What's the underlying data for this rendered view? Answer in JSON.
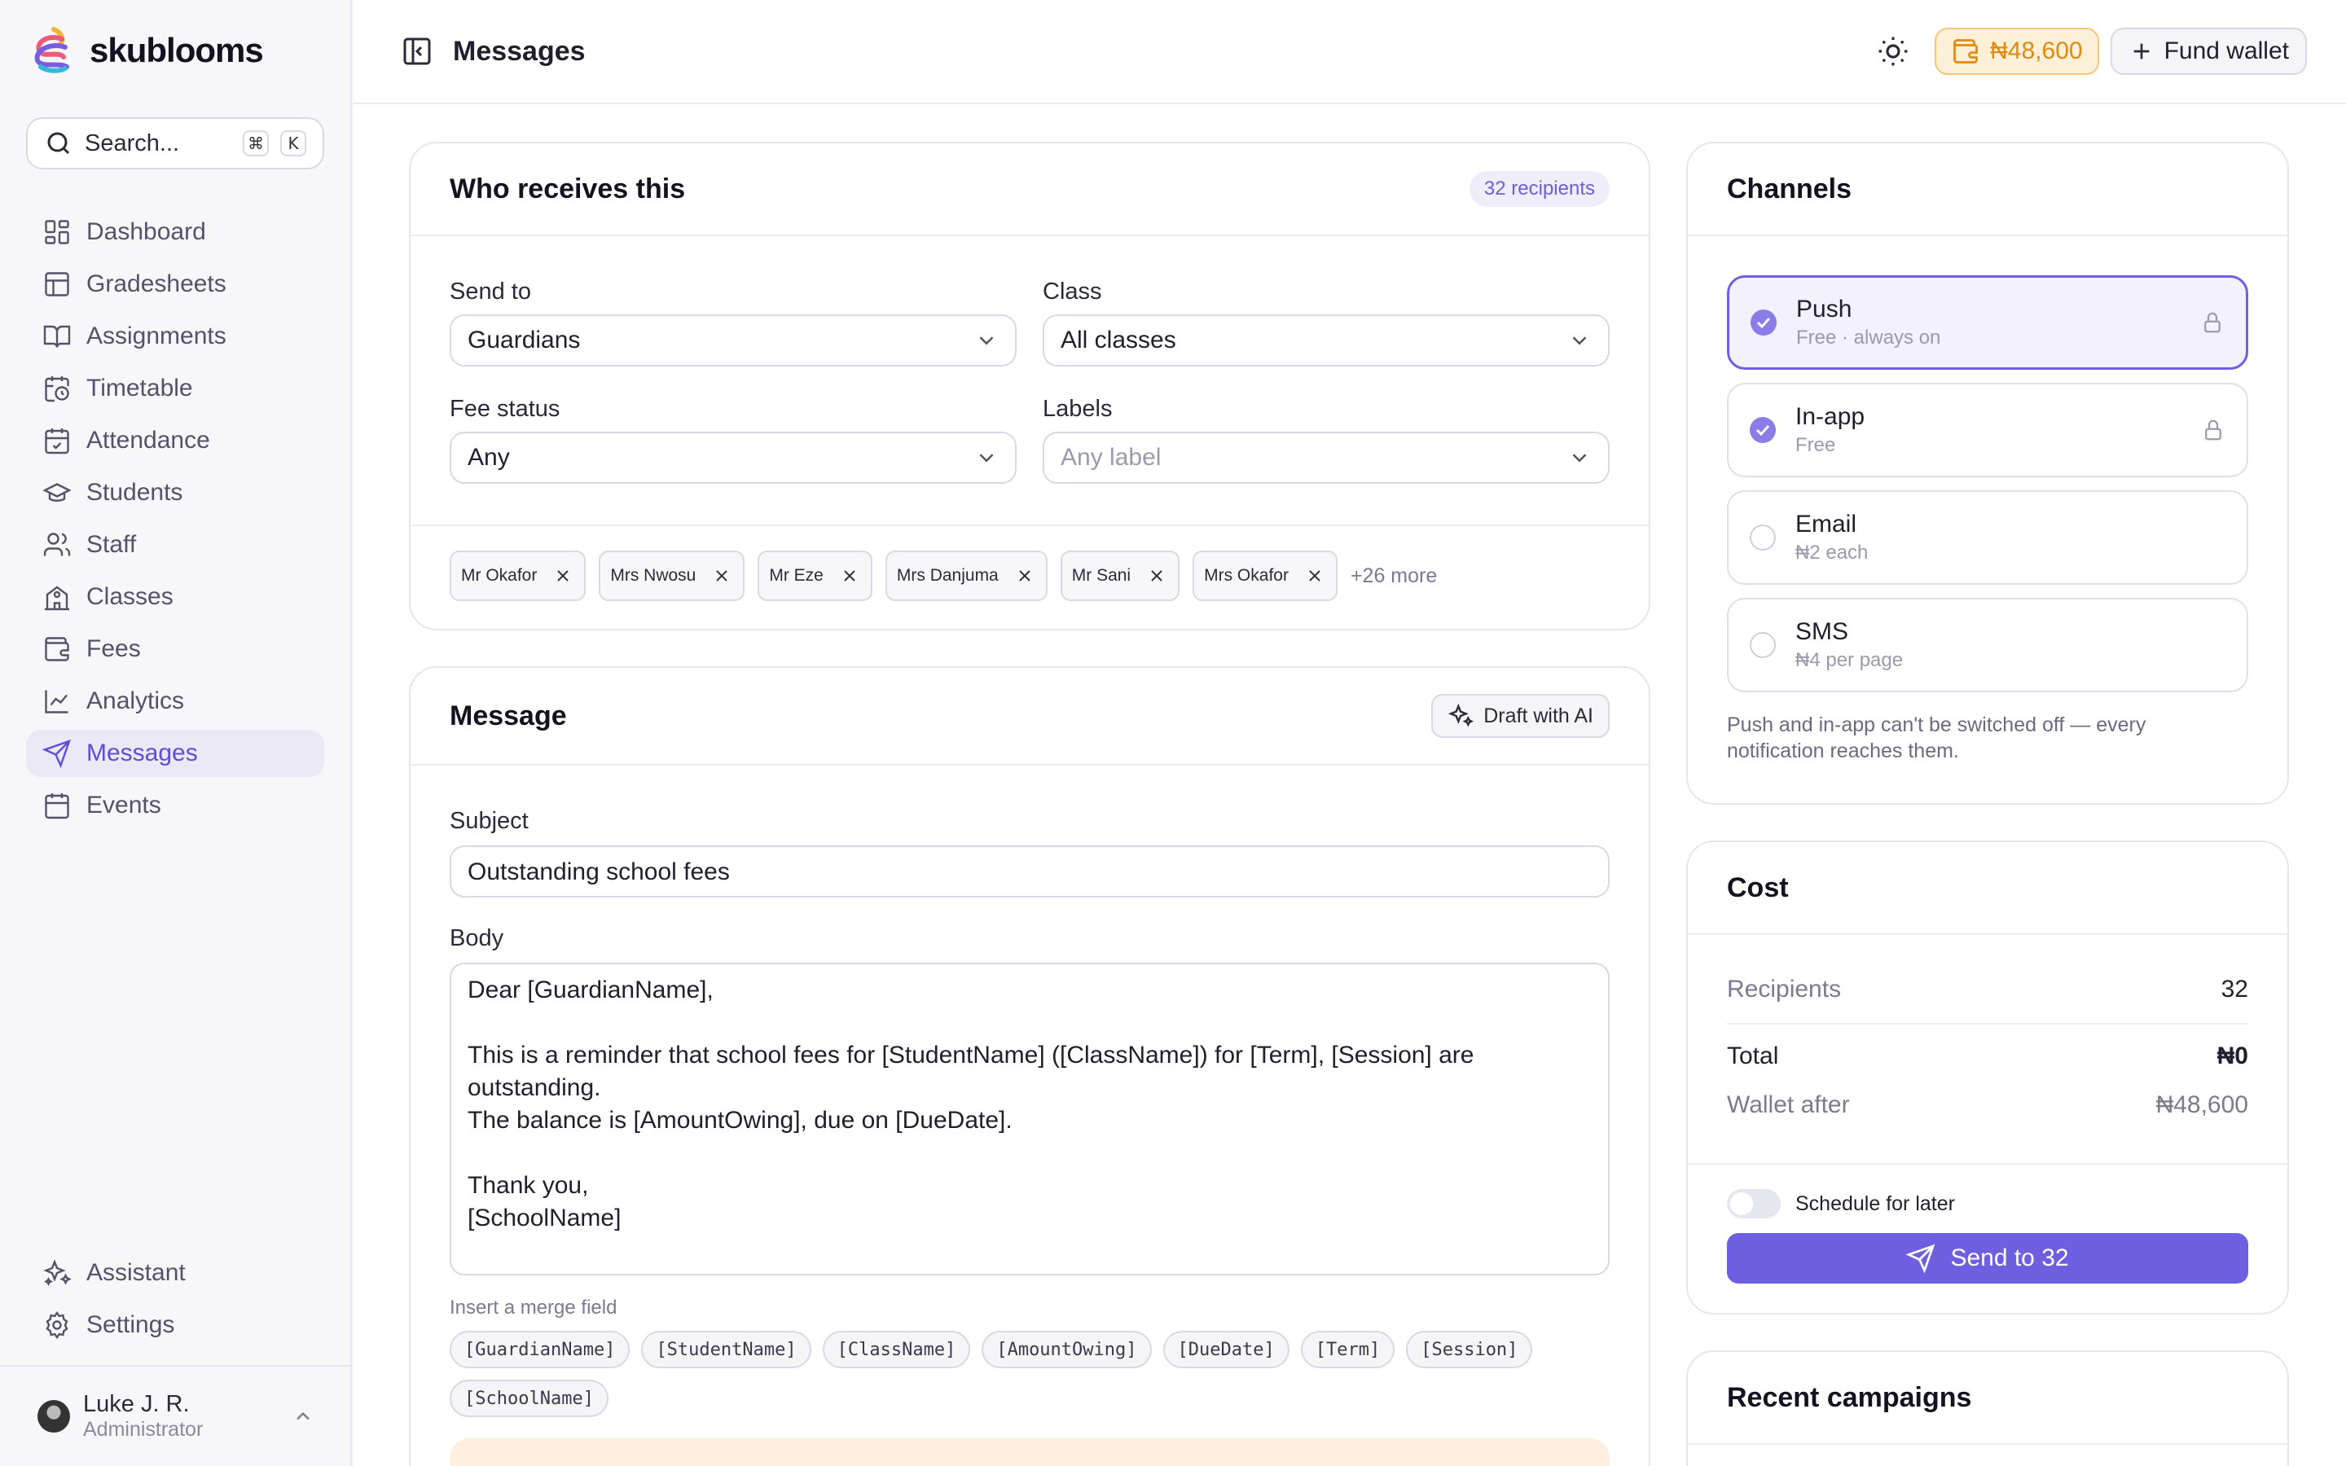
{
  "app": {
    "name": "skublooms"
  },
  "search": {
    "placeholder": "Search...",
    "kbd1": "⌘",
    "kbd2": "K"
  },
  "nav": {
    "items": [
      {
        "label": "Dashboard",
        "icon": "dashboard-icon"
      },
      {
        "label": "Gradesheets",
        "icon": "grid-icon"
      },
      {
        "label": "Assignments",
        "icon": "book-icon"
      },
      {
        "label": "Timetable",
        "icon": "calendar-clock-icon"
      },
      {
        "label": "Attendance",
        "icon": "calendar-check-icon"
      },
      {
        "label": "Students",
        "icon": "graduation-cap-icon"
      },
      {
        "label": "Staff",
        "icon": "users-icon"
      },
      {
        "label": "Classes",
        "icon": "school-icon"
      },
      {
        "label": "Fees",
        "icon": "wallet-icon"
      },
      {
        "label": "Analytics",
        "icon": "chart-line-icon"
      },
      {
        "label": "Messages",
        "icon": "send-icon",
        "active": true
      },
      {
        "label": "Events",
        "icon": "calendar-icon"
      }
    ],
    "bottom": [
      {
        "label": "Assistant",
        "icon": "sparkles-icon"
      },
      {
        "label": "Settings",
        "icon": "gear-icon"
      }
    ]
  },
  "user": {
    "name": "Luke J. R.",
    "role": "Administrator"
  },
  "topbar": {
    "title": "Messages",
    "wallet": "₦48,600",
    "fund": "Fund wallet"
  },
  "recipients": {
    "title": "Who receives this",
    "count": "32 recipients",
    "send_to_label": "Send to",
    "send_to_value": "Guardians",
    "class_label": "Class",
    "class_value": "All classes",
    "fee_label": "Fee status",
    "fee_value": "Any",
    "labels_label": "Labels",
    "labels_placeholder": "Any label",
    "chips": [
      "Mr Okafor",
      "Mrs Nwosu",
      "Mr Eze",
      "Mrs Danjuma",
      "Mr Sani",
      "Mrs Okafor"
    ],
    "more": "+26 more"
  },
  "message": {
    "title": "Message",
    "draft": "Draft with AI",
    "subject_label": "Subject",
    "subject_value": "Outstanding school fees",
    "body_label": "Body",
    "body_value": "Dear [GuardianName],\n\nThis is a reminder that school fees for [StudentName] ([ClassName]) for [Term], [Session] are outstanding.\nThe balance is [AmountOwing], due on [DueDate].\n\nThank you,\n[SchoolName]",
    "merge_label": "Insert a merge field",
    "merge_fields": [
      "[GuardianName]",
      "[StudentName]",
      "[ClassName]",
      "[AmountOwing]",
      "[DueDate]",
      "[Term]",
      "[Session]",
      "[SchoolName]"
    ]
  },
  "channels": {
    "title": "Channels",
    "items": [
      {
        "name": "Push",
        "sub": "Free · always on",
        "checked": true,
        "locked": true,
        "selected": true
      },
      {
        "name": "In-app",
        "sub": "Free",
        "checked": true,
        "locked": true
      },
      {
        "name": "Email",
        "sub": "₦2 each",
        "checked": false
      },
      {
        "name": "SMS",
        "sub": "₦4 per page",
        "checked": false
      }
    ],
    "note": "Push and in-app can't be switched off — every notification reaches them."
  },
  "cost": {
    "title": "Cost",
    "recipients_label": "Recipients",
    "recipients_value": "32",
    "total_label": "Total",
    "total_value": "₦0",
    "wallet_label": "Wallet after",
    "wallet_value": "₦48,600",
    "schedule_label": "Schedule for later",
    "send_label": "Send to 32"
  },
  "recent": {
    "title": "Recent campaigns"
  },
  "colors": {
    "accent": "#6d5fe0",
    "wallet": "#e08a10",
    "active_nav_bg": "#ebe9f6"
  }
}
